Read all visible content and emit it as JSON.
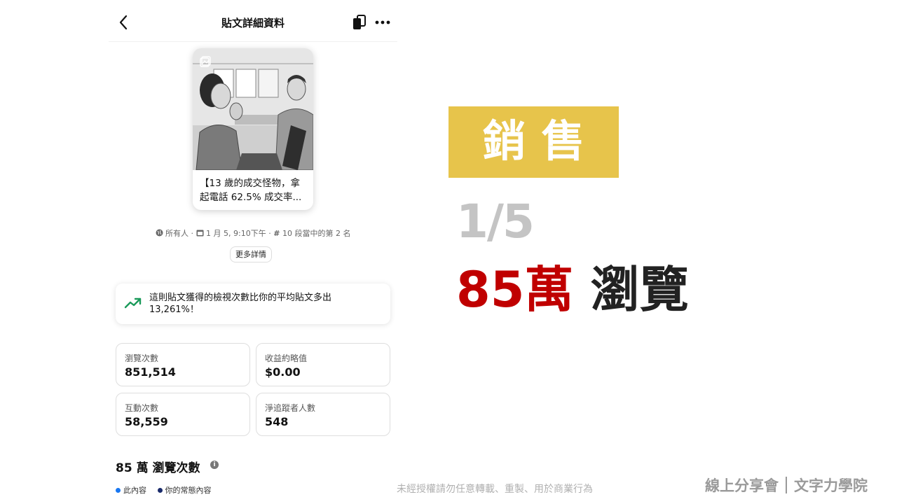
{
  "phone": {
    "header": {
      "title": "貼文詳細資料"
    },
    "post": {
      "caption": "【13 歲的成交怪物，拿起電話 62.5% 成交率..."
    },
    "meta": {
      "audience": "所有人",
      "date": "1 月 5, 9:10下午",
      "rank": "10 段當中的第 2 名"
    },
    "more_details_label": "更多詳情",
    "insight": {
      "text": "這則貼文獲得的檢視次數比你的平均貼文多出 13,261%！",
      "color": "#1a9a5a"
    },
    "metrics": [
      {
        "label": "瀏覽次數",
        "value": "851,514"
      },
      {
        "label": "收益約略值",
        "value": "$0.00"
      },
      {
        "label": "互動次數",
        "value": "58,559"
      },
      {
        "label": "淨追蹤者人數",
        "value": "548"
      }
    ],
    "views_heading": "85 萬 瀏覽次數",
    "legend": [
      {
        "label": "此內容",
        "color": "#1877f2"
      },
      {
        "label": "你的常態內容",
        "color": "#1a2b6b"
      }
    ]
  },
  "slide": {
    "badge": {
      "text": "銷售",
      "color": "#e7c44b"
    },
    "counter": "1/5",
    "headline_number": "85萬",
    "headline_text": "瀏覽",
    "watermark": "未經授權請勿任意轉載、重製、用於商業行為",
    "brand_left": "線上分享會",
    "brand_right": "文字力學院"
  },
  "icons": [
    "back-arrow-icon",
    "copy-icon",
    "more-icon",
    "photo-icon",
    "globe-icon",
    "calendar-icon",
    "hashtag-icon",
    "trending-up-icon",
    "info-icon"
  ]
}
